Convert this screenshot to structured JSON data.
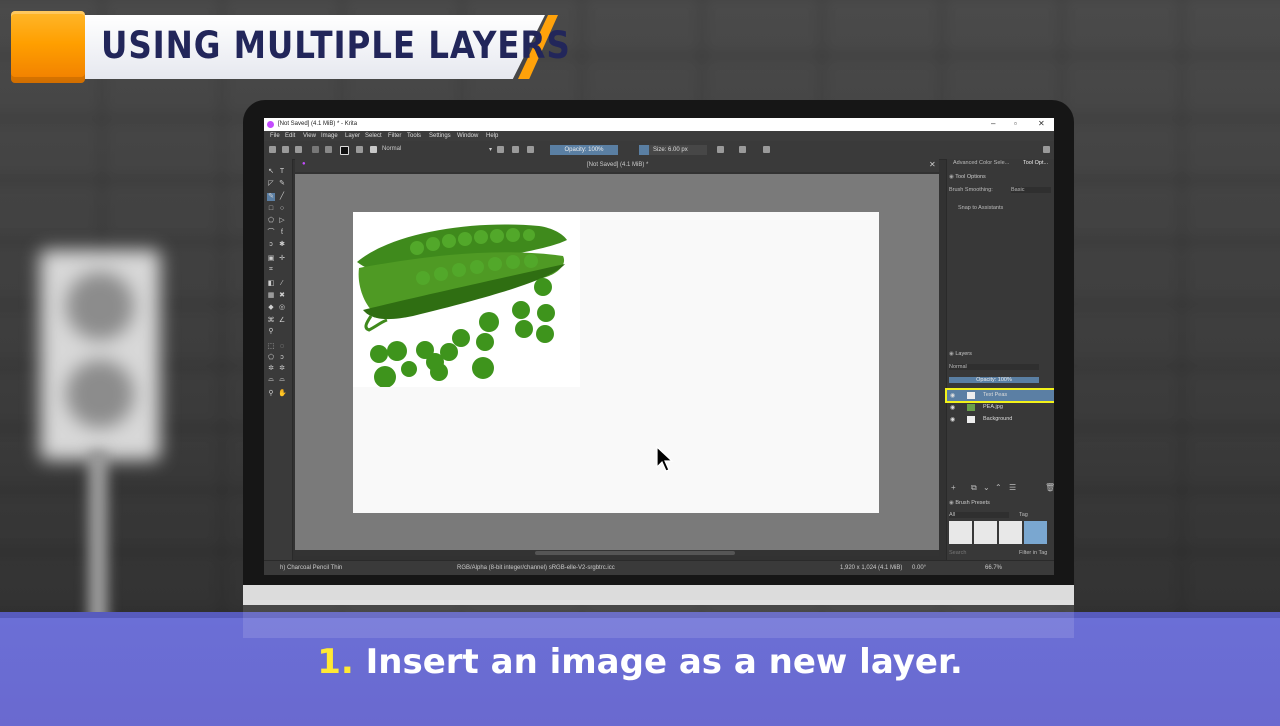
{
  "banner": {
    "title": "USING MULTIPLE LAYERS"
  },
  "caption": {
    "number": "1.",
    "text": "Insert an image as a new layer."
  },
  "krita": {
    "window_title": "[Not Saved]  (4.1 MiB) * - Krita",
    "menu": [
      "File",
      "Edit",
      "View",
      "Image",
      "Layer",
      "Select",
      "Filter",
      "Tools",
      "Settings",
      "Window",
      "Help"
    ],
    "toolbar": {
      "blend_mode": "Normal",
      "opacity": "Opacity: 100%",
      "size": "Size: 6.00 px"
    },
    "doc_tab": "[Not Saved]  (4.1 MiB) *",
    "dock_tabs": [
      "Advanced Color Sele...",
      "Tool Opt..."
    ],
    "tool_options": {
      "title": "Tool Options",
      "brush_smoothing_label": "Brush Smoothing:",
      "brush_smoothing_value": "Basic",
      "snap_label": "Snap to Assistants"
    },
    "layers": {
      "title": "Layers",
      "blend_mode": "Normal",
      "opacity": "Opacity: 100%",
      "items": [
        {
          "name": "Text Peas",
          "selected": true
        },
        {
          "name": "PEA.jpg",
          "selected": false
        },
        {
          "name": "Background",
          "selected": false
        }
      ]
    },
    "brush_presets": {
      "title": "Brush Presets",
      "filter": "All",
      "tag": "Tag",
      "search_placeholder": "Search",
      "filter_in_tag": "Filter in Tag"
    },
    "status": {
      "brush": "h) Charcoal Pencil Thin",
      "color_space": "RGB/Alpha (8-bit integer/channel)  sRGB-elle-V2-srgbtrc.icc",
      "dimensions": "1,920 x 1,024 (4.1 MiB)",
      "rotation": "0.00°",
      "zoom": "66.7%"
    }
  },
  "colors": {
    "accent_orange": "#ff9f00",
    "title_navy": "#22265a",
    "caption_bg": "#6b6fd6",
    "highlight": "#f2f21a"
  }
}
